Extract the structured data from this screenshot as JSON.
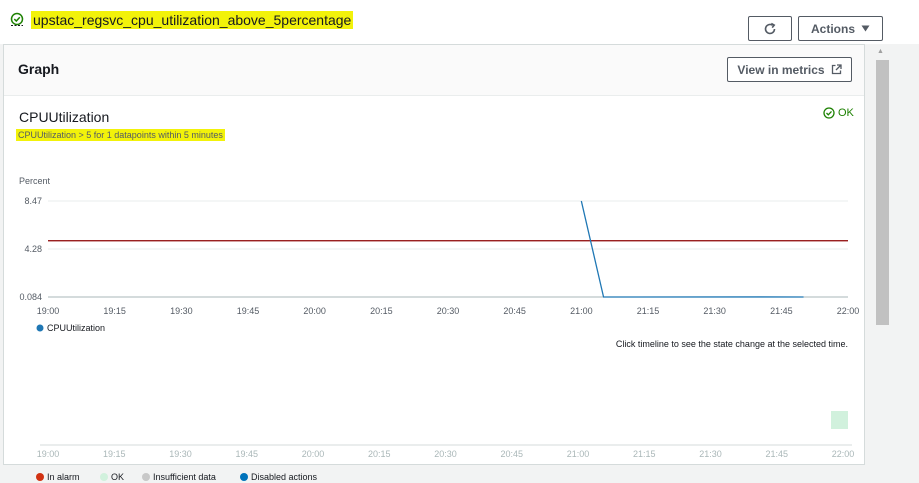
{
  "header": {
    "alarm_name": "upstac_regsvc_cpu_utilization_above_5percentage",
    "actions_label": "Actions",
    "refresh_icon": "refresh-icon"
  },
  "panel": {
    "title": "Graph",
    "view_in_metrics_label": "View in metrics",
    "chart_title": "CPUUtilization",
    "chart_subtitle": "CPUUtilization > 5 for 1 datapoints within 5 minutes",
    "state_label": "OK",
    "y_axis_label": "Percent",
    "timeline_hint": "Click timeline to see the state change at the selected time."
  },
  "colors": {
    "series": "#1f77b4",
    "threshold": "#8b0000",
    "ok": "#1d8102",
    "in_alarm": "#d13212",
    "ok_legend": "#d1f1dd",
    "insufficient": "#c8c8c8",
    "disabled": "#0073bb"
  },
  "chart_data": {
    "type": "line",
    "y_ticks": [
      "8.47",
      "4.28",
      "0.084"
    ],
    "y_range": [
      0.084,
      8.47
    ],
    "x_ticks": [
      "19:00",
      "19:15",
      "19:30",
      "19:45",
      "20:00",
      "20:15",
      "20:30",
      "20:45",
      "21:00",
      "21:15",
      "21:30",
      "21:45",
      "22:00"
    ],
    "threshold": 5,
    "series": [
      {
        "name": "CPUUtilization",
        "points": [
          {
            "x": "21:00",
            "y": 8.47
          },
          {
            "x": "21:05",
            "y": 0.084
          },
          {
            "x": "21:40",
            "y": 0.09
          },
          {
            "x": "21:50",
            "y": 0.084
          }
        ]
      }
    ]
  },
  "timeline": {
    "x_ticks": [
      "19:00",
      "19:15",
      "19:30",
      "19:45",
      "20:00",
      "20:15",
      "20:30",
      "20:45",
      "21:00",
      "21:15",
      "21:30",
      "21:45",
      "22:00"
    ],
    "ok_block": {
      "start": "21:58",
      "end": "22:00"
    },
    "legend": [
      {
        "label": "In alarm",
        "color_key": "in_alarm"
      },
      {
        "label": "OK",
        "color_key": "ok_legend"
      },
      {
        "label": "Insufficient data",
        "color_key": "insufficient"
      },
      {
        "label": "Disabled actions",
        "color_key": "disabled"
      }
    ]
  }
}
